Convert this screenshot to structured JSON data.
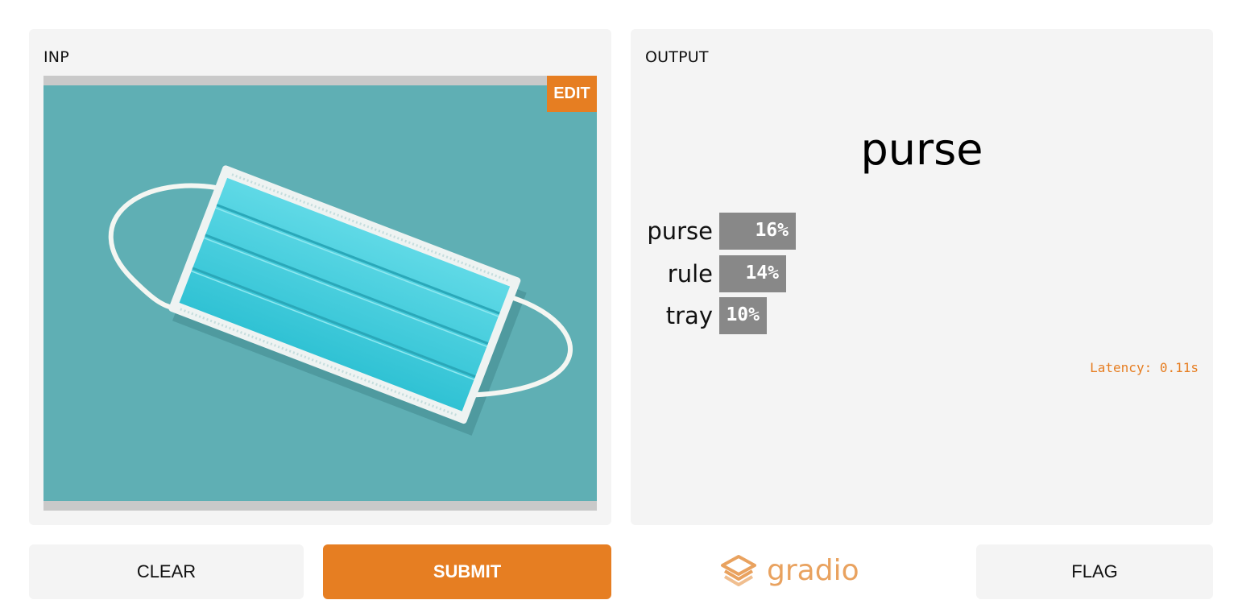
{
  "input": {
    "title": "INP",
    "edit_label": "EDIT",
    "image_subject": "surgical face mask on teal background"
  },
  "output": {
    "title": "OUTPUT",
    "prediction": "purse",
    "labels": [
      {
        "name": "purse",
        "percent_text": "16%",
        "confidence": 0.16
      },
      {
        "name": "rule",
        "percent_text": "14%",
        "confidence": 0.14
      },
      {
        "name": "tray",
        "percent_text": "10%",
        "confidence": 0.1
      }
    ],
    "latency": "Latency: 0.11s"
  },
  "buttons": {
    "clear": "CLEAR",
    "submit": "SUBMIT",
    "flag": "FLAG"
  },
  "brand": {
    "name": "gradio",
    "icon": "gradio-logo-icon"
  },
  "colors": {
    "accent": "#e67e22",
    "bar": "#888888",
    "panel": "#f4f4f4",
    "photo_bg": "#5fb0b5",
    "brand": "#e9a25f"
  }
}
